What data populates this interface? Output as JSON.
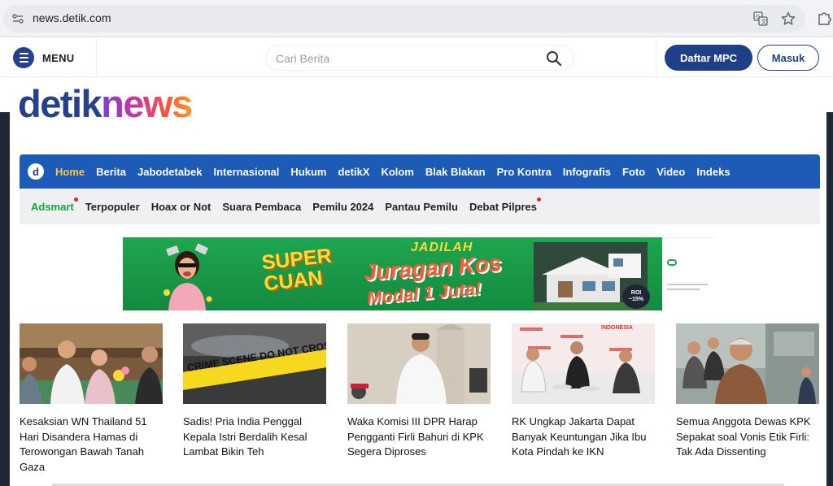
{
  "browser": {
    "url": "news.detik.com",
    "icons": [
      "site-info-icon",
      "translate-icon",
      "star-icon",
      "extensions-icon"
    ]
  },
  "header": {
    "menu_label": "MENU",
    "search_placeholder": "Cari Berita",
    "register_label": "Daftar MPC",
    "login_label": "Masuk"
  },
  "logo": {
    "part1": "detik",
    "part2": "news"
  },
  "nav": {
    "logo_letter": "d",
    "items": [
      {
        "label": "Home",
        "active": true
      },
      {
        "label": "Berita"
      },
      {
        "label": "Jabodetabek"
      },
      {
        "label": "Internasional"
      },
      {
        "label": "Hukum"
      },
      {
        "label": "detikX"
      },
      {
        "label": "Kolom"
      },
      {
        "label": "Blak Blakan"
      },
      {
        "label": "Pro Kontra"
      },
      {
        "label": "Infografis"
      },
      {
        "label": "Foto"
      },
      {
        "label": "Video"
      },
      {
        "label": "Indeks"
      }
    ]
  },
  "subnav": {
    "items": [
      {
        "label": "Adsmart",
        "dot": true
      },
      {
        "label": "Terpopuler"
      },
      {
        "label": "Hoax or Not"
      },
      {
        "label": "Suara Pembaca"
      },
      {
        "label": "Pemilu 2024"
      },
      {
        "label": "Pantau Pemilu"
      },
      {
        "label": "Debat Pilpres",
        "dot": true
      }
    ]
  },
  "ad": {
    "line1": "SUPER",
    "line2": "CUAN",
    "jadilah": "JADILAH",
    "juragan": "Juragan Kos",
    "modal": "Modal 1 Juta!",
    "roi_top": "ROI",
    "roi_value": "~15%"
  },
  "articles": [
    {
      "title": "Kesaksian WN Thailand 51 Hari Disandera Hamas di Terowongan Bawah Tanah Gaza"
    },
    {
      "title": "Sadis! Pria India Penggal Kepala Istri Berdalih Kesal Lambat Bikin Teh",
      "image_text": "CRIME SCENE DO NOT CROSS"
    },
    {
      "title": "Waka Komisi III DPR Harap Pengganti Firli Bahuri di KPK Segera Diproses"
    },
    {
      "title": "RK Ungkap Jakarta Dapat Banyak Keuntungan Jika Ibu Kota Pindah ke IKN",
      "image_text": "INDONESIA"
    },
    {
      "title": "Semua Anggota Dewas KPK Sepakat soal Vonis Etik Firli: Tak Ada Dissenting"
    }
  ],
  "colors": {
    "brand_blue": "#1f3f87",
    "nav_blue": "#1e5bb7",
    "active_nav": "#ffc93c",
    "adsmart_green": "#18a340",
    "dot_red": "#e3242b"
  }
}
